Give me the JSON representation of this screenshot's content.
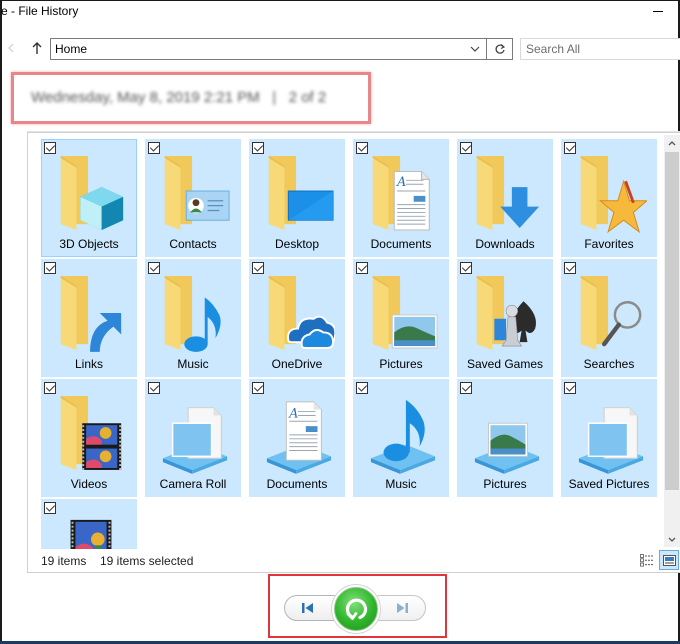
{
  "window": {
    "title": "e - File History",
    "minimize_icon": "minimize-icon"
  },
  "toolbar": {
    "back_icon": "chevron-left-icon",
    "up_icon": "up-arrow-icon",
    "address_value": "Home",
    "address_dropdown_icon": "chevron-down-icon",
    "refresh_icon": "refresh-icon",
    "search_placeholder": "Search All"
  },
  "snapshot": {
    "date": "Wednesday, May 8, 2019 2:21 PM",
    "separator": "|",
    "position": "2 of 2",
    "highlight_color": "#e8878a"
  },
  "items": [
    {
      "label": "3D Objects",
      "icon": "3d-objects-folder-icon",
      "checked": true,
      "selected": true
    },
    {
      "label": "Contacts",
      "icon": "contacts-folder-icon",
      "checked": true
    },
    {
      "label": "Desktop",
      "icon": "desktop-folder-icon",
      "checked": true
    },
    {
      "label": "Documents",
      "icon": "documents-folder-icon",
      "checked": true
    },
    {
      "label": "Downloads",
      "icon": "downloads-folder-icon",
      "checked": true
    },
    {
      "label": "Favorites",
      "icon": "favorites-folder-icon",
      "checked": true
    },
    {
      "label": "Links",
      "icon": "links-folder-icon",
      "checked": true
    },
    {
      "label": "Music",
      "icon": "music-folder-icon",
      "checked": true
    },
    {
      "label": "OneDrive",
      "icon": "onedrive-folder-icon",
      "checked": true
    },
    {
      "label": "Pictures",
      "icon": "pictures-folder-icon",
      "checked": true
    },
    {
      "label": "Saved Games",
      "icon": "saved-games-folder-icon",
      "checked": true
    },
    {
      "label": "Searches",
      "icon": "searches-folder-icon",
      "checked": true
    },
    {
      "label": "Videos",
      "icon": "videos-folder-icon",
      "checked": true
    },
    {
      "label": "Camera Roll",
      "icon": "camera-roll-library-icon",
      "checked": true
    },
    {
      "label": "Documents",
      "icon": "documents-library-icon",
      "checked": true
    },
    {
      "label": "Music",
      "icon": "music-library-icon",
      "checked": true
    },
    {
      "label": "Pictures",
      "icon": "pictures-library-icon",
      "checked": true
    },
    {
      "label": "Saved Pictures",
      "icon": "saved-pictures-library-icon",
      "checked": true
    },
    {
      "label": "",
      "icon": "videos-library-icon",
      "checked": true
    }
  ],
  "status": {
    "item_count": "19 items",
    "selected_count": "19 items selected"
  },
  "view_toggle": {
    "details_icon": "details-view-icon",
    "large_icons_icon": "large-icons-view-icon",
    "active": "large-icons"
  },
  "navigation": {
    "previous_icon": "previous-version-icon",
    "restore_icon": "restore-icon",
    "next_icon": "next-version-icon",
    "restore_color": "#2fb52b",
    "highlight_color": "#e0353b"
  }
}
